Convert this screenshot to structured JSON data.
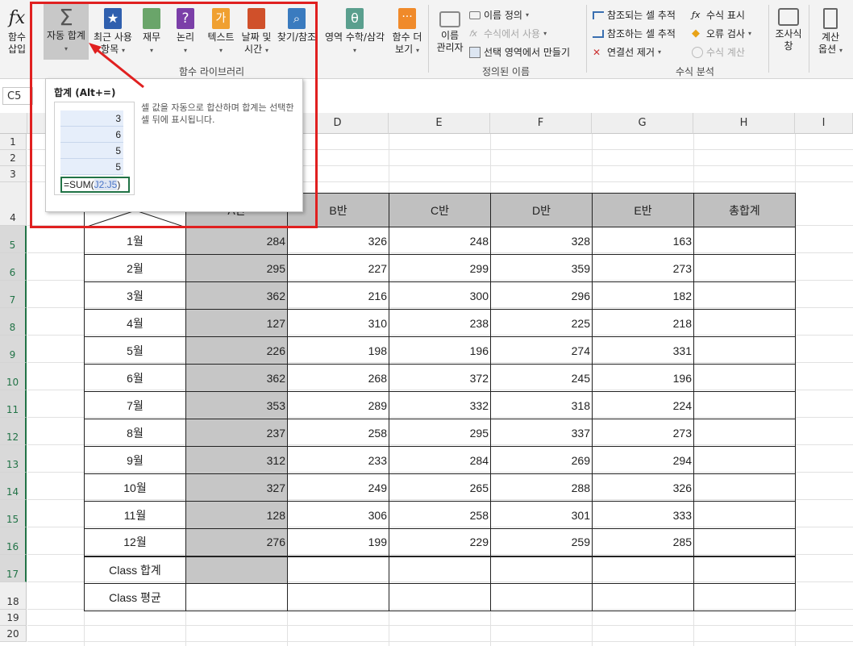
{
  "ribbon": {
    "insert_function": {
      "label1": "함수",
      "label2": "삽입"
    },
    "autosum": {
      "label1": "자동 합계",
      "caret": "▾"
    },
    "recent": {
      "label1": "최근 사용",
      "label2": "항목"
    },
    "finance": {
      "label": "재무"
    },
    "logic": {
      "label": "논리"
    },
    "text": {
      "label": "텍스트"
    },
    "datetime": {
      "label1": "날짜 및",
      "label2": "시간"
    },
    "lookup": {
      "label": "찾기/참조"
    },
    "math": {
      "label": "영역 수학/삼각"
    },
    "more": {
      "label1": "함수 더",
      "label2": "보기"
    },
    "function_library_label": "함수 라이브러리",
    "name_manager": {
      "label1": "이름",
      "label2": "관리자"
    },
    "define_name": "이름 정의",
    "use_in_formula": "수식에서 사용",
    "create_from_selection": "선택 영역에서 만들기",
    "defined_names_label": "정의된 이름",
    "trace_precedents": "참조되는 셀 추적",
    "trace_dependents": "참조하는 셀 추적",
    "remove_arrows": "연결선 제거",
    "show_formulas": "수식 표시",
    "error_checking": "오류 검사",
    "evaluate_formula": "수식 계산",
    "formula_auditing_label": "수식 분석",
    "watch_window": {
      "label1": "조사식",
      "label2": "창"
    },
    "calc_options": {
      "label1": "계산",
      "label2": "옵션"
    }
  },
  "namebox": "C5",
  "tooltip": {
    "title": "합계 (Alt+=)",
    "description": "셀 값을 자동으로 합산하며 합계는 선택한 셀 뒤에 표시됩니다.",
    "preview_values": [
      "3",
      "6",
      "5",
      "5"
    ],
    "formula_prefix": "=SUM(",
    "formula_ref": "J2:J5",
    "formula_suffix": ")"
  },
  "columns": [
    "D",
    "E",
    "F",
    "G",
    "H",
    "I"
  ],
  "rows": [
    "1",
    "2",
    "3",
    "4",
    "5",
    "6",
    "7",
    "8",
    "9",
    "10",
    "11",
    "12",
    "13",
    "14",
    "15",
    "16",
    "17",
    "18",
    "19",
    "20"
  ],
  "table": {
    "headers": [
      "",
      "A반",
      "B반",
      "C반",
      "D반",
      "E반",
      "총합계"
    ],
    "rows": [
      {
        "label": "1월",
        "values": [
          "284",
          "326",
          "248",
          "328",
          "163"
        ]
      },
      {
        "label": "2월",
        "values": [
          "295",
          "227",
          "299",
          "359",
          "273"
        ]
      },
      {
        "label": "3월",
        "values": [
          "362",
          "216",
          "300",
          "296",
          "182"
        ]
      },
      {
        "label": "4월",
        "values": [
          "127",
          "310",
          "238",
          "225",
          "218"
        ]
      },
      {
        "label": "5월",
        "values": [
          "226",
          "198",
          "196",
          "274",
          "331"
        ]
      },
      {
        "label": "6월",
        "values": [
          "362",
          "268",
          "372",
          "245",
          "196"
        ]
      },
      {
        "label": "7월",
        "values": [
          "353",
          "289",
          "332",
          "318",
          "224"
        ]
      },
      {
        "label": "8월",
        "values": [
          "237",
          "258",
          "295",
          "337",
          "273"
        ]
      },
      {
        "label": "9월",
        "values": [
          "312",
          "233",
          "284",
          "269",
          "294"
        ]
      },
      {
        "label": "10월",
        "values": [
          "327",
          "249",
          "265",
          "288",
          "326"
        ]
      },
      {
        "label": "11월",
        "values": [
          "128",
          "306",
          "258",
          "301",
          "333"
        ]
      },
      {
        "label": "12월",
        "values": [
          "276",
          "199",
          "229",
          "259",
          "285"
        ]
      }
    ],
    "footer": [
      "Class 합계",
      "Class 평균"
    ]
  },
  "colors": {
    "accent": "#217346",
    "highlight": "#e02020",
    "header_fill": "#c0c0c0"
  }
}
